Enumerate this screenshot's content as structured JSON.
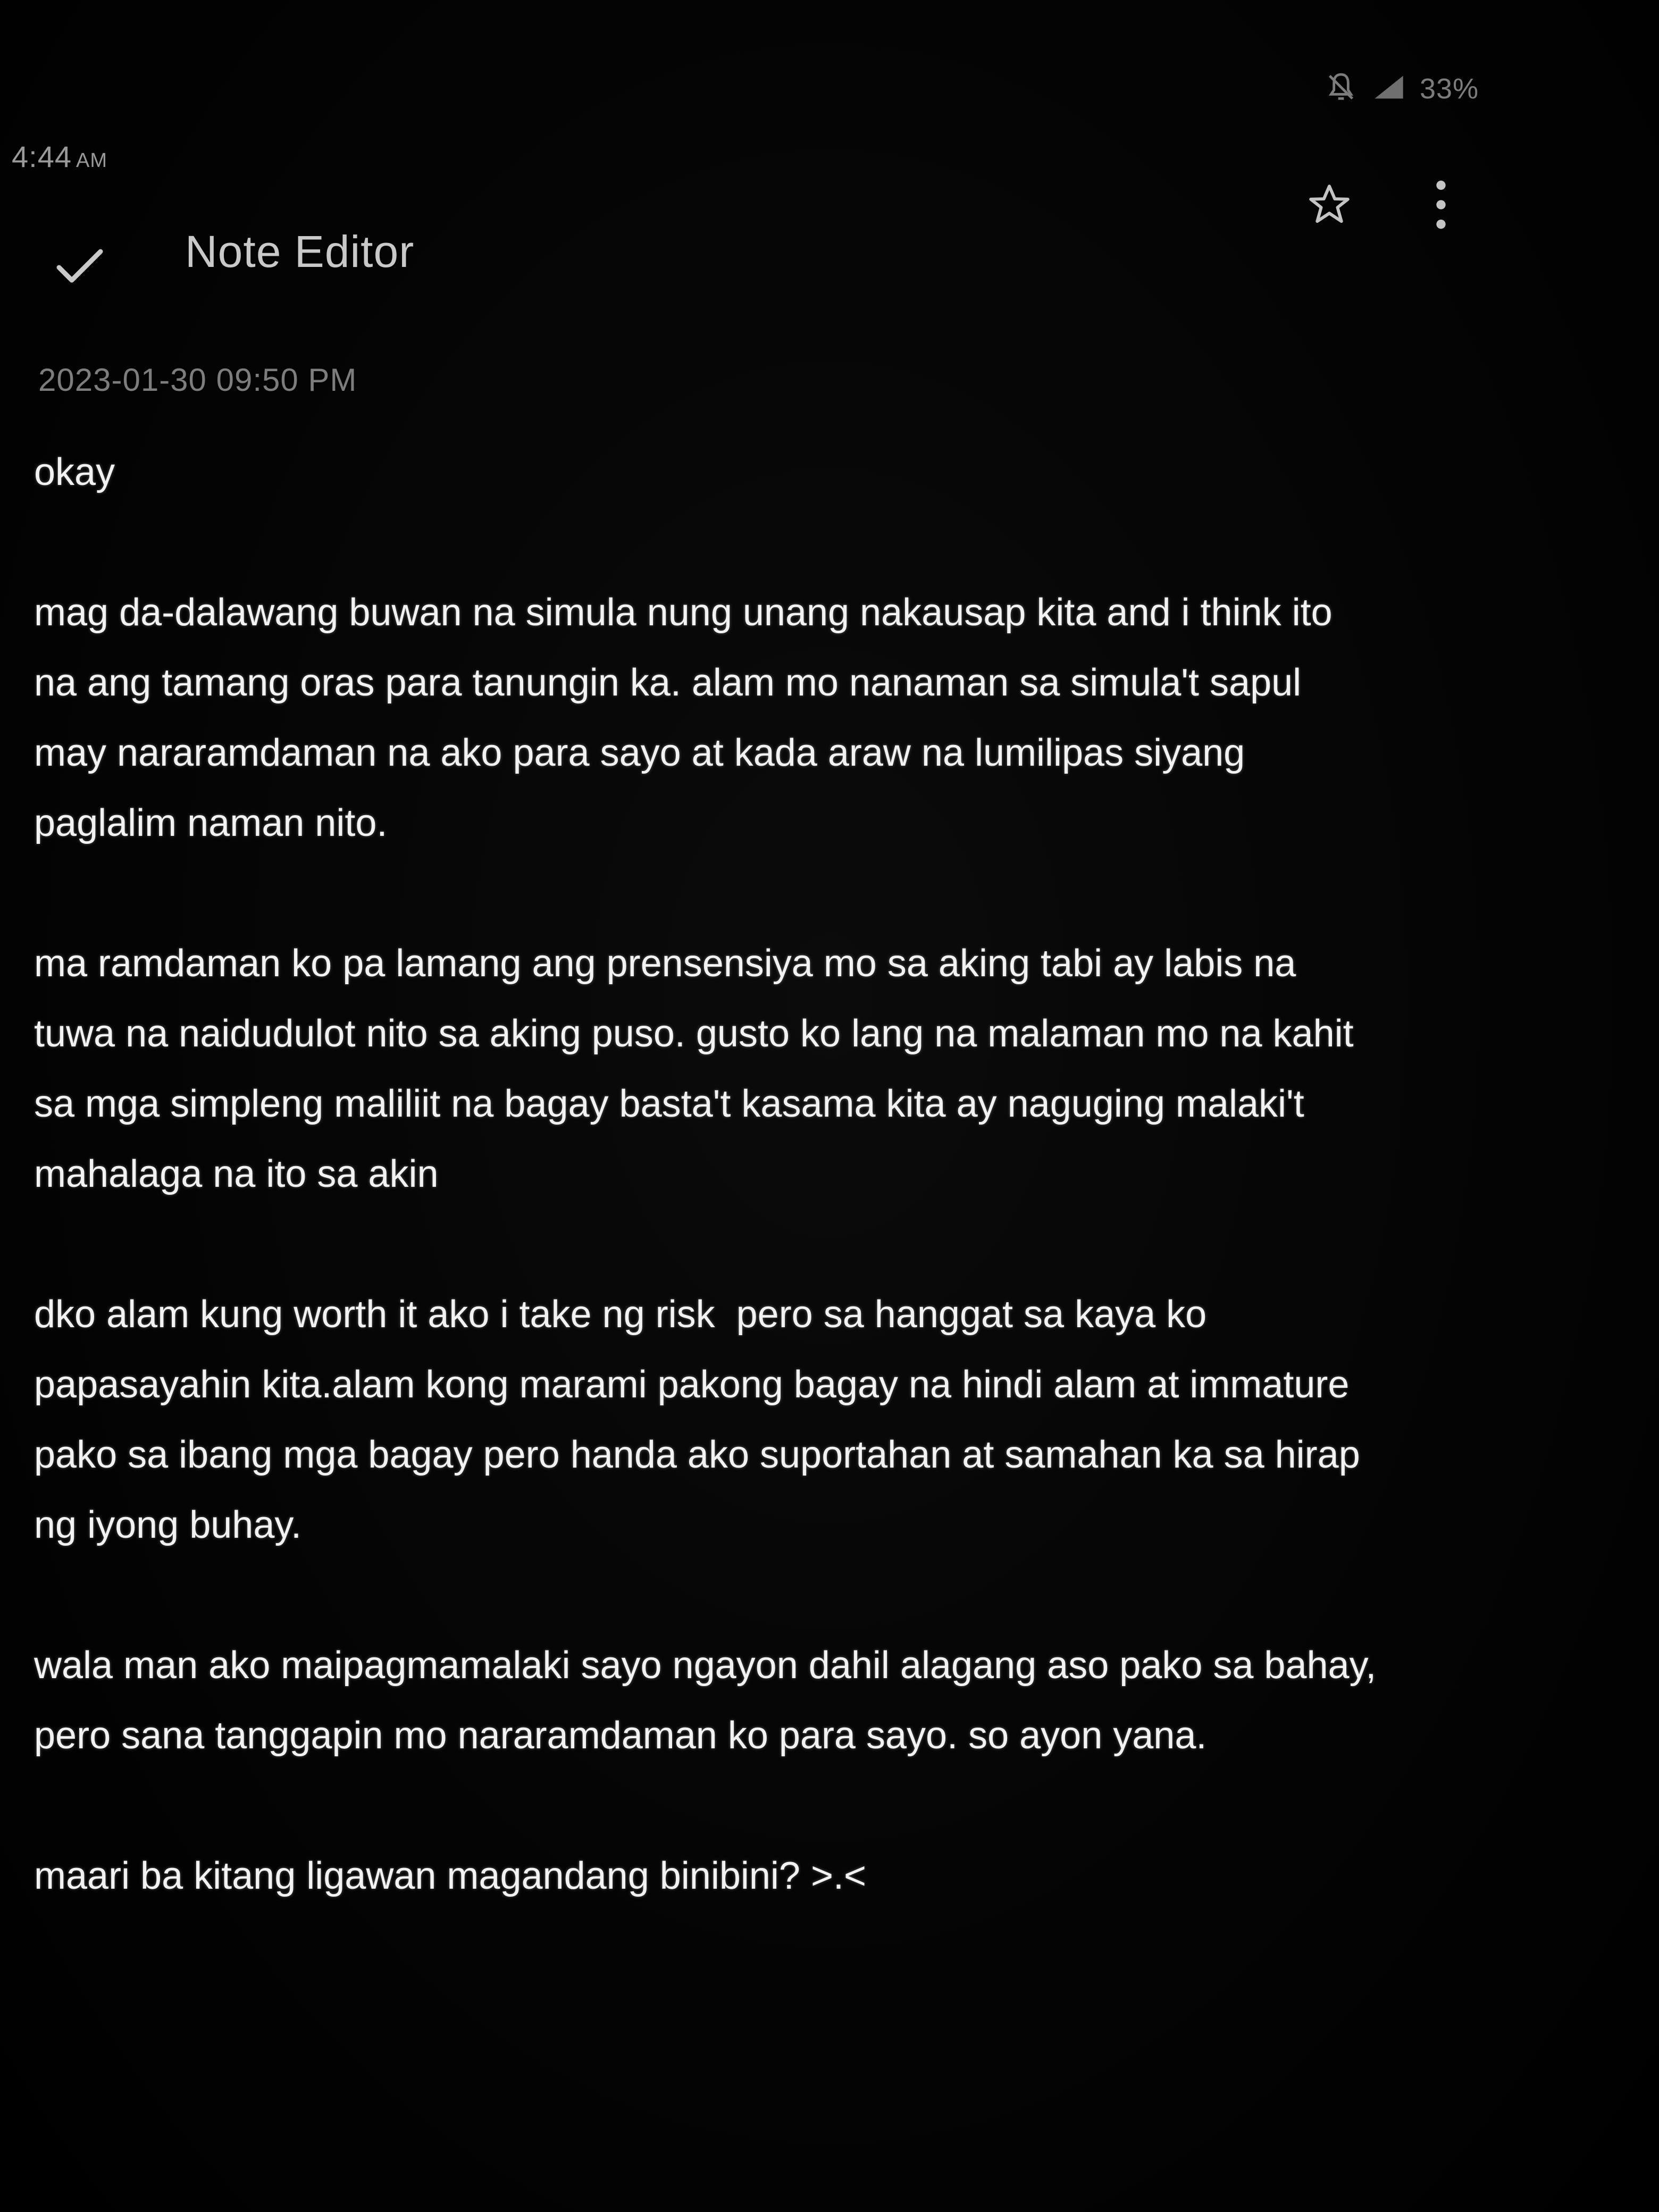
{
  "status_bar": {
    "time": "4:44",
    "ampm": "AM",
    "battery": "33%",
    "icons": [
      "mute-icon",
      "signal-icon"
    ]
  },
  "app_bar": {
    "title": "Note Editor",
    "done_icon": "check-icon",
    "favorite_icon": "star-icon",
    "more_icon": "more-vertical-icon"
  },
  "note": {
    "timestamp": "2023-01-30 09:50 PM",
    "body": "okay\n\nmag da-dalawang buwan na simula nung unang nakausap kita and i think ito\nna ang tamang oras para tanungin ka. alam mo nanaman sa simula't sapul\nmay nararamdaman na ako para sayo at kada araw na lumilipas siyang\npaglalim naman nito.\n\nma ramdaman ko pa lamang ang prensensiya mo sa aking tabi ay labis na\ntuwa na naidudulot nito sa aking puso. gusto ko lang na malaman mo na kahit\nsa mga simpleng maliliit na bagay basta't kasama kita ay naguging malaki't\nmahalaga na ito sa akin\n\ndko alam kung worth it ako i take ng risk  pero sa hanggat sa kaya ko\npapasayahin kita.alam kong marami pakong bagay na hindi alam at immature\npako sa ibang mga bagay pero handa ako suportahan at samahan ka sa hirap\nng iyong buhay.\n\nwala man ako maipagmamalaki sayo ngayon dahil alagang aso pako sa bahay,\npero sana tanggapin mo nararamdaman ko para sayo. so ayon yana.\n\nmaari ba kitang ligawan magandang binibini? >.<"
  },
  "colors": {
    "background": "#000000",
    "title": "#c9c9c9",
    "body_text": "#f2f2f2",
    "timestamp": "#7d7d7d",
    "status": "#7c7c7c"
  }
}
